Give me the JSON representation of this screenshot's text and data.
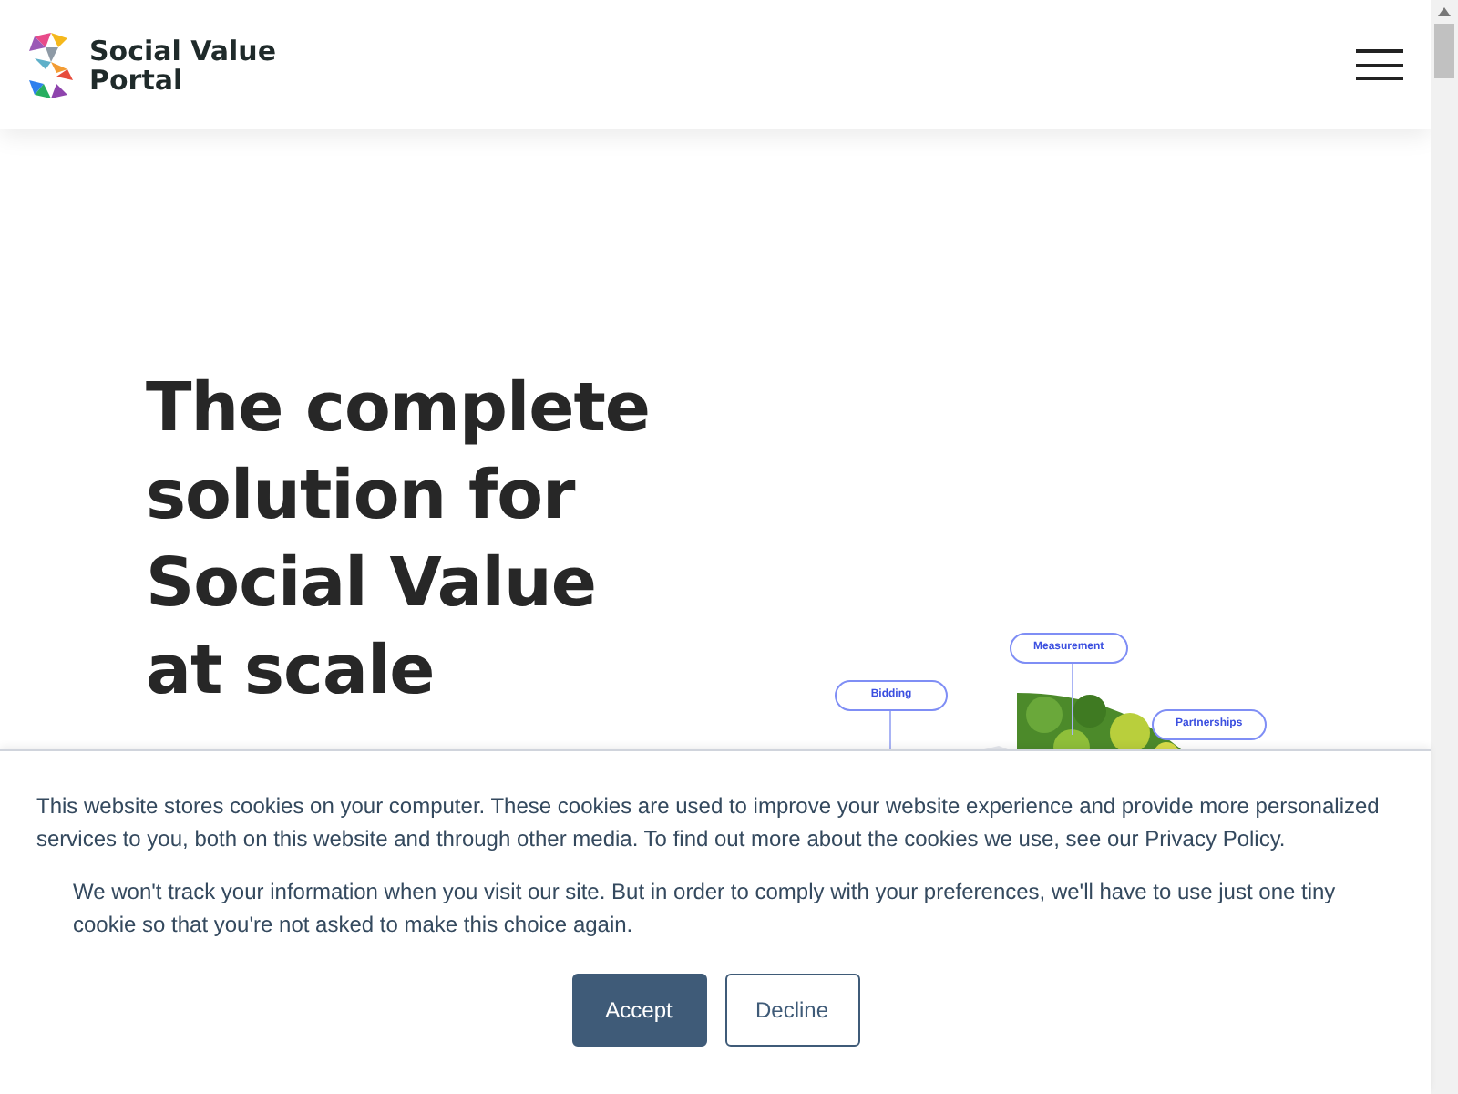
{
  "header": {
    "logo_line_1": "Social Value",
    "logo_line_2": "Portal"
  },
  "hero": {
    "heading_lines": [
      "The complete",
      "solution for",
      "Social Value",
      "at scale"
    ]
  },
  "diagram": {
    "labels": [
      {
        "text": "Measurement"
      },
      {
        "text": "Bidding"
      },
      {
        "text": "Partnerships"
      }
    ]
  },
  "cookie_banner": {
    "message": "This website stores cookies on your computer. These cookies are used to improve your website experience and provide more personalized services to you, both on this website and through other media. To find out more about the cookies we use, see our Privacy Policy.",
    "note": "We won't track your information when you visit our site. But in order to comply with your preferences, we'll have to use just one tiny cookie so that you're not asked to make this choice again.",
    "buttons": [
      {
        "label": "Accept",
        "kind": "primary"
      },
      {
        "label": "Decline",
        "kind": "secondary"
      }
    ]
  }
}
